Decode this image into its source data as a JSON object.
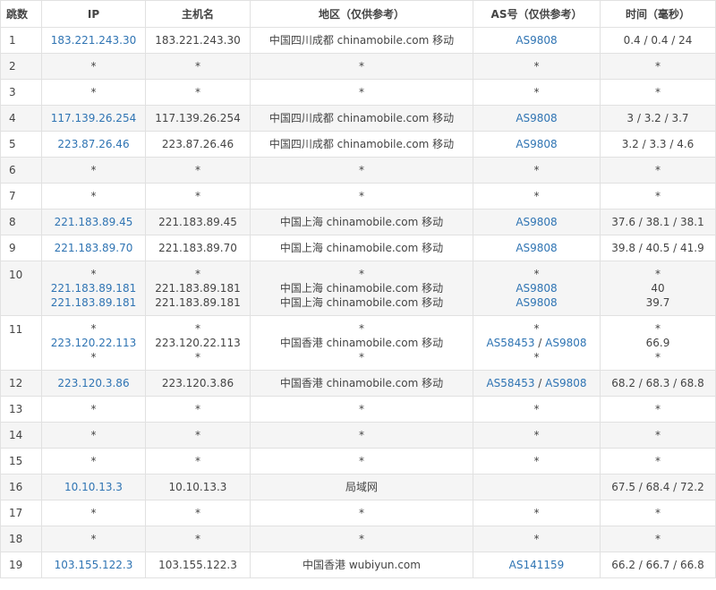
{
  "headers": {
    "hop": "跳数",
    "ip": "IP",
    "hostname": "主机名",
    "region": "地区（仅供参考）",
    "asn": "AS号（仅供参考）",
    "time": "时间（毫秒）"
  },
  "rows": [
    {
      "hop": "1",
      "lines": [
        {
          "ip": "183.221.243.30",
          "host": "183.221.243.30",
          "region": "中国四川成都 chinamobile.com 移动",
          "asn": [
            "AS9808"
          ],
          "time": "0.4 / 0.4 / 24"
        }
      ]
    },
    {
      "hop": "2",
      "lines": [
        {
          "ip": "*",
          "host": "*",
          "region": "*",
          "asn": [
            "*"
          ],
          "time": "*"
        }
      ]
    },
    {
      "hop": "3",
      "lines": [
        {
          "ip": "*",
          "host": "*",
          "region": "*",
          "asn": [
            "*"
          ],
          "time": "*"
        }
      ]
    },
    {
      "hop": "4",
      "lines": [
        {
          "ip": "117.139.26.254",
          "host": "117.139.26.254",
          "region": "中国四川成都 chinamobile.com 移动",
          "asn": [
            "AS9808"
          ],
          "time": "3 / 3.2 / 3.7"
        }
      ]
    },
    {
      "hop": "5",
      "lines": [
        {
          "ip": "223.87.26.46",
          "host": "223.87.26.46",
          "region": "中国四川成都 chinamobile.com 移动",
          "asn": [
            "AS9808"
          ],
          "time": "3.2 / 3.3 / 4.6"
        }
      ]
    },
    {
      "hop": "6",
      "lines": [
        {
          "ip": "*",
          "host": "*",
          "region": "*",
          "asn": [
            "*"
          ],
          "time": "*"
        }
      ]
    },
    {
      "hop": "7",
      "lines": [
        {
          "ip": "*",
          "host": "*",
          "region": "*",
          "asn": [
            "*"
          ],
          "time": "*"
        }
      ]
    },
    {
      "hop": "8",
      "lines": [
        {
          "ip": "221.183.89.45",
          "host": "221.183.89.45",
          "region": "中国上海 chinamobile.com 移动",
          "asn": [
            "AS9808"
          ],
          "time": "37.6 / 38.1 / 38.1"
        }
      ]
    },
    {
      "hop": "9",
      "lines": [
        {
          "ip": "221.183.89.70",
          "host": "221.183.89.70",
          "region": "中国上海 chinamobile.com 移动",
          "asn": [
            "AS9808"
          ],
          "time": "39.8 / 40.5 / 41.9"
        }
      ]
    },
    {
      "hop": "10",
      "lines": [
        {
          "ip": "*",
          "host": "*",
          "region": "*",
          "asn": [
            "*"
          ],
          "time": "*"
        },
        {
          "ip": "221.183.89.181",
          "host": "221.183.89.181",
          "region": "中国上海 chinamobile.com 移动",
          "asn": [
            "AS9808"
          ],
          "time": "40"
        },
        {
          "ip": "221.183.89.181",
          "host": "221.183.89.181",
          "region": "中国上海 chinamobile.com 移动",
          "asn": [
            "AS9808"
          ],
          "time": "39.7"
        }
      ]
    },
    {
      "hop": "11",
      "lines": [
        {
          "ip": "*",
          "host": "*",
          "region": "*",
          "asn": [
            "*"
          ],
          "time": "*"
        },
        {
          "ip": "223.120.22.113",
          "host": "223.120.22.113",
          "region": "中国香港 chinamobile.com 移动",
          "asn": [
            "AS58453",
            "AS9808"
          ],
          "time": "66.9"
        },
        {
          "ip": "*",
          "host": "*",
          "region": "*",
          "asn": [
            "*"
          ],
          "time": "*"
        }
      ]
    },
    {
      "hop": "12",
      "lines": [
        {
          "ip": "223.120.3.86",
          "host": "223.120.3.86",
          "region": "中国香港 chinamobile.com 移动",
          "asn": [
            "AS58453",
            "AS9808"
          ],
          "time": "68.2 / 68.3 / 68.8"
        }
      ]
    },
    {
      "hop": "13",
      "lines": [
        {
          "ip": "*",
          "host": "*",
          "region": "*",
          "asn": [
            "*"
          ],
          "time": "*"
        }
      ]
    },
    {
      "hop": "14",
      "lines": [
        {
          "ip": "*",
          "host": "*",
          "region": "*",
          "asn": [
            "*"
          ],
          "time": "*"
        }
      ]
    },
    {
      "hop": "15",
      "lines": [
        {
          "ip": "*",
          "host": "*",
          "region": "*",
          "asn": [
            "*"
          ],
          "time": "*"
        }
      ]
    },
    {
      "hop": "16",
      "lines": [
        {
          "ip": "10.10.13.3",
          "host": "10.10.13.3",
          "region": "局域网",
          "asn": [],
          "time": "67.5 / 68.4 / 72.2"
        }
      ]
    },
    {
      "hop": "17",
      "lines": [
        {
          "ip": "*",
          "host": "*",
          "region": "*",
          "asn": [
            "*"
          ],
          "time": "*"
        }
      ]
    },
    {
      "hop": "18",
      "lines": [
        {
          "ip": "*",
          "host": "*",
          "region": "*",
          "asn": [
            "*"
          ],
          "time": "*"
        }
      ]
    },
    {
      "hop": "19",
      "lines": [
        {
          "ip": "103.155.122.3",
          "host": "103.155.122.3",
          "region": "中国香港 wubiyun.com",
          "asn": [
            "AS141159"
          ],
          "time": "66.2 / 66.7 / 66.8"
        }
      ]
    }
  ],
  "colors": {
    "link": "#2f74b3",
    "text": "#444444",
    "border": "#e1e1e1",
    "stripe": "#f5f5f5"
  }
}
